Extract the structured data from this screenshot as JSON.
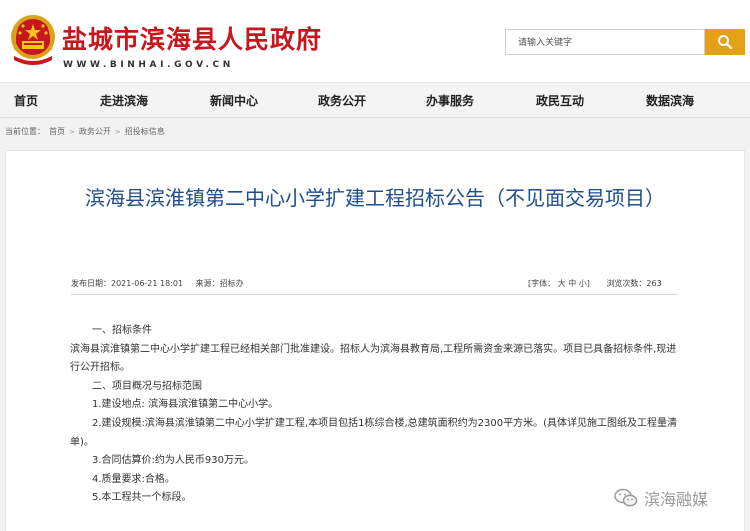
{
  "header": {
    "site_title": "盐城市滨海县人民政府",
    "site_url": "WWW.BINHAI.GOV.CN",
    "search_placeholder": "请输入关键字"
  },
  "nav": {
    "items": [
      "首页",
      "走进滨海",
      "新闻中心",
      "政务公开",
      "办事服务",
      "政民互动",
      "数据滨海"
    ]
  },
  "breadcrumb": {
    "label": "当前位置：",
    "items": [
      "首页",
      "政务公开",
      "招投标信息"
    ]
  },
  "article": {
    "title": "滨海县滨淮镇第二中心小学扩建工程招标公告（不见面交易项目）",
    "publish_date": "发布日期：2021-06-21 18:01",
    "source": "来源：招标办",
    "font_size_label": "[字体：",
    "font_large": "大",
    "font_medium": "中",
    "font_small": "小",
    "font_close": "]",
    "views": "浏览次数：263",
    "paragraphs": [
      "一、招标条件",
      "滨海县滨淮镇第二中心小学扩建工程已经相关部门批准建设。招标人为滨海县教育局,工程所需资金来源已落实。项目已具备招标条件,现进行公开招标。",
      "二、项目概况与招标范围",
      "1.建设地点: 滨海县滨淮镇第二中心小学。",
      "2.建设规模:滨海县滨淮镇第二中心小学扩建工程,本项目包括1栋综合楼,总建筑面积约为2300平方米。(具体详见施工图纸及工程量清单)。",
      "3.合同估算价:约为人民币930万元。",
      "4.质量要求:合格。",
      "5.本工程共一个标段。"
    ]
  },
  "watermark": {
    "text": "滨海融媒"
  },
  "colors": {
    "brand_red": "#c8161d",
    "title_blue": "#1f4e8c",
    "search_button": "#e6a016"
  }
}
